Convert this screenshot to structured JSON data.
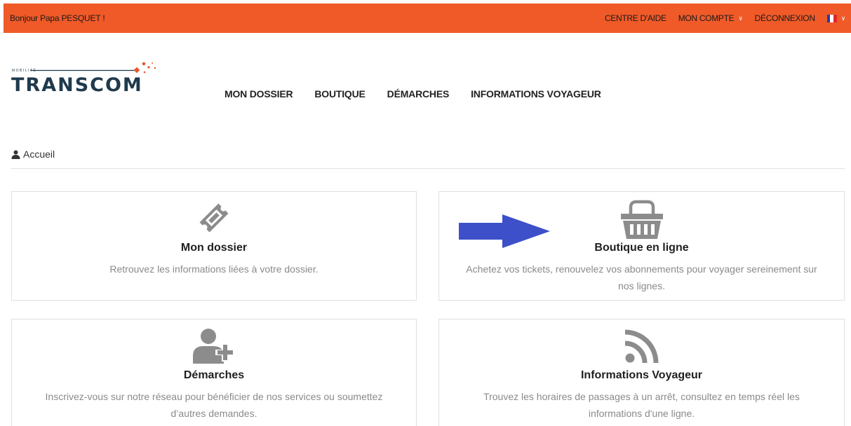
{
  "topbar": {
    "greeting": "Bonjour Papa PESQUET !",
    "help": "CENTRE D'AIDE",
    "account": "MON COMPTE",
    "logout": "DÉCONNEXION",
    "language": "fr"
  },
  "logo": {
    "small_text": "MOBILITÉ",
    "brand": "TRANSCOM"
  },
  "nav": {
    "items": [
      "MON DOSSIER",
      "BOUTIQUE",
      "DÉMARCHES",
      "INFORMATIONS VOYAGEUR"
    ]
  },
  "breadcrumb": {
    "label": "Accueil",
    "icon": "user-icon"
  },
  "cards": [
    {
      "title": "Mon dossier",
      "description": "Retrouvez les informations liées à votre dossier.",
      "icon": "ticket-icon"
    },
    {
      "title": "Boutique en ligne",
      "description": "Achetez vos tickets, renouvelez vos abonnements pour voyager sereinement sur nos lignes.",
      "icon": "basket-icon"
    },
    {
      "title": "Démarches",
      "description": "Inscrivez-vous sur notre réseau pour bénéficier de nos services ou soumettez d’autres demandes.",
      "icon": "user-plus-icon"
    },
    {
      "title": "Informations Voyageur",
      "description": "Trouvez les horaires de passages à un arrêt, consultez en temps réel les informations d'une ligne.",
      "icon": "rss-icon"
    }
  ],
  "colors": {
    "topbar": "#f05a28",
    "icon_gray": "#8c8c8c",
    "arrow": "#3d4fc9",
    "brand_dark": "#1f3a4d",
    "brand_orange": "#e8562a"
  }
}
